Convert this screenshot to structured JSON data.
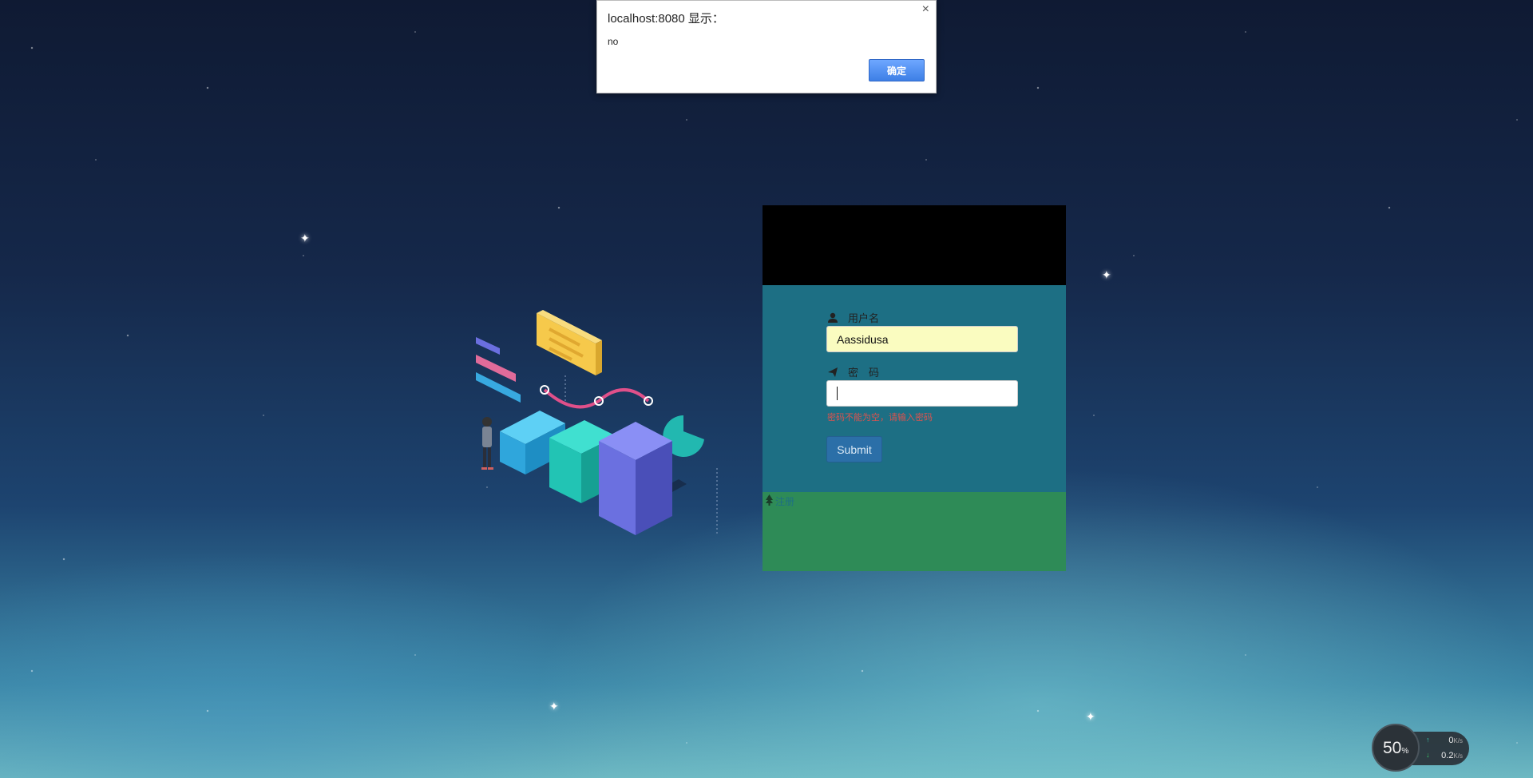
{
  "alert": {
    "title": "localhost:8080 显示：",
    "message": "no",
    "ok_label": "确定",
    "close_glyph": "×"
  },
  "login": {
    "username_label": "用户名",
    "username_value": "Aassidusa",
    "password_label": "密　码",
    "password_value": "",
    "error_message": "密码不能为空，请输入密码",
    "submit_label": "Submit",
    "footer_link": "注册",
    "colors": {
      "header": "#000000",
      "body": "#1d6f84",
      "footer": "#2e8b57",
      "error": "#d9534f",
      "submit": "#2b6fa8",
      "username_bg": "#fafcc0"
    },
    "icons": {
      "username": "user-icon",
      "password": "send-icon",
      "footer": "tree-icon"
    }
  },
  "network_widget": {
    "percent": "50",
    "percent_sign": "%",
    "upload_value": "0",
    "upload_unit": "K/s",
    "download_value": "0.2",
    "download_unit": "K/s"
  }
}
